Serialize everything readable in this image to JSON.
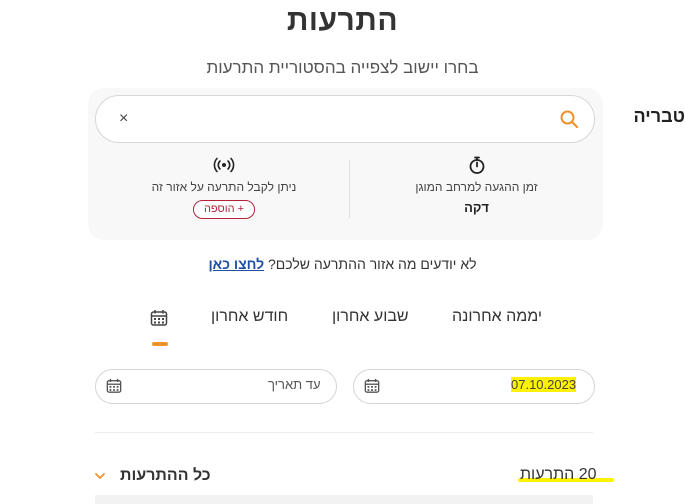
{
  "page": {
    "title": "התרעות",
    "subtitle": "בחרו יישוב לצפייה בהסטוריית התרעות"
  },
  "search": {
    "value": "טבריה",
    "clear_symbol": "×"
  },
  "info": {
    "arrival_time_label": "זמן ההגעה למרחב המוגן",
    "arrival_time_value": "דקה",
    "area_alert_label": "ניתן לקבל התרעה על אזור זה",
    "add_label": "+ הוספה"
  },
  "help": {
    "question": "לא יודעים מה אזור ההתרעה שלכם?",
    "link": "לחצו כאן"
  },
  "tabs": [
    {
      "label": "יממה אחרונה",
      "active": false
    },
    {
      "label": "שבוע אחרון",
      "active": false
    },
    {
      "label": "חודש אחרון",
      "active": false
    },
    {
      "label": "",
      "icon": "calendar-icon",
      "active": true
    }
  ],
  "date_range": {
    "from_value": "07.10.2023",
    "to_placeholder": "עד תאריך"
  },
  "results": {
    "count_label": "20 התרעות",
    "filter_label": "כל ההתרעות"
  },
  "colors": {
    "accent_orange": "#f0922b",
    "link_blue": "#1f4fa3",
    "add_red": "#b3223b",
    "highlight_yellow": "#fff200"
  }
}
